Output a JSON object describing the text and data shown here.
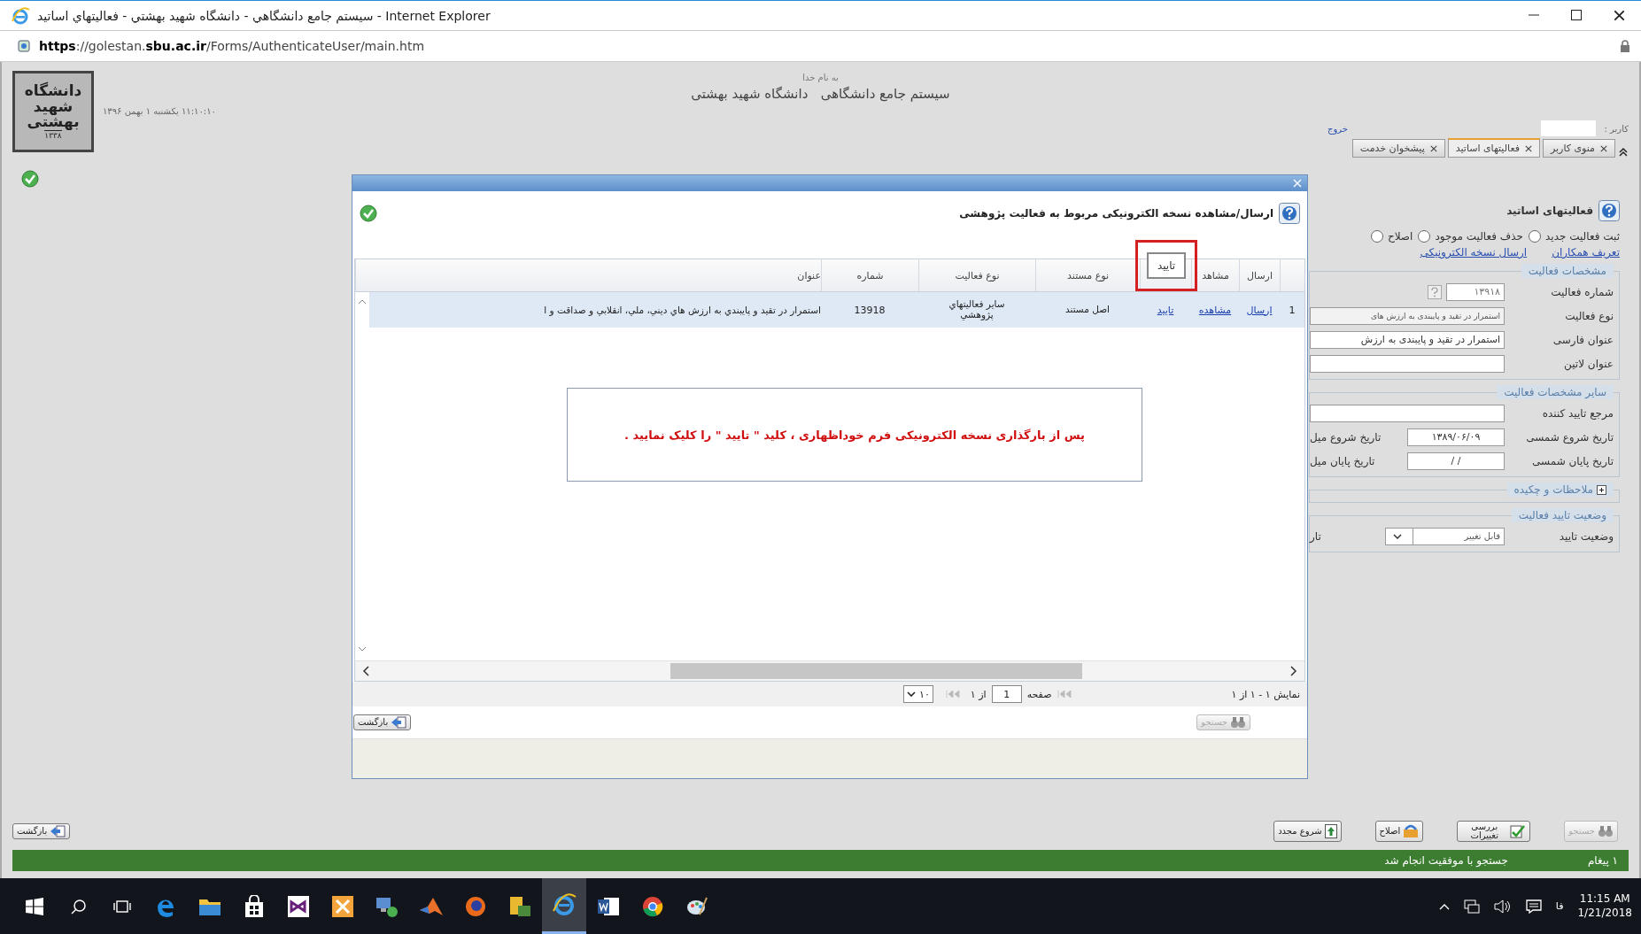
{
  "window": {
    "title": "Internet Explorer - سيستم جامع دانشگاهي - دانشگاه شهيد بهشتي - فعاليتهاي اساتيد"
  },
  "address_bar": {
    "url": "**https**://golestan.**sbu.ac.ir**/Forms/AuthenticateUser/main.htm"
  },
  "header": {
    "logo_text": "دانشگاه شهید بهشتی",
    "logo_year": "۱۳۳۸",
    "date_time": "۱۱:۱۰:۱۰ یکشنبه ۱ بهمن ۱۳۹۶",
    "basmala": "به نام خدا",
    "system_title": "سیستم جامع دانشگاهی   دانشگاه شهید بهشتی",
    "user_label": "کاربر :",
    "logout": "خروج"
  },
  "tabs": [
    {
      "label": "منوی کاربر",
      "selected": false
    },
    {
      "label": "فعالیتهای اساتید",
      "selected": true
    },
    {
      "label": "پیشخوان خدمت",
      "selected": false
    }
  ],
  "panel": {
    "title": "فعالیتهای اساتید",
    "modes": [
      {
        "label": "ثبت فعالیت جدید",
        "selected": false
      },
      {
        "label": "حذف فعالیت موجود",
        "selected": false
      },
      {
        "label": "اصلاح",
        "selected": false
      }
    ],
    "links": [
      "تعریف همکاران",
      "ارسال نسخه الکترونیکی"
    ],
    "sections": [
      {
        "legend": "مشخصات فعالیت",
        "expanded": true,
        "rows": [
          {
            "label": "شماره فعالیت",
            "value": "۱۳۹۱۸",
            "kind": "number"
          },
          {
            "label": "نوع فعالیت",
            "value": "استمرار در تقيد و پايبندی به ارزش های",
            "kind": "readonly"
          },
          {
            "label": "عنوان فارسی",
            "value": "استمرار در تقيد و پايبندی به ارزش",
            "kind": "text"
          },
          {
            "label": "عنوان لاتین",
            "kind": "text"
          }
        ]
      },
      {
        "legend": "سایر مشخصات فعالیت",
        "expanded": true,
        "rows": [
          {
            "label": "مرجع تایید کننده",
            "kind": "text"
          },
          {
            "label": "تاریخ شروع شمسی",
            "value": "۱۳۸۹/۰۶/۰۹",
            "kind": "date",
            "extra": "تاریخ شروع میل"
          },
          {
            "label": "تاریخ پایان شمسی",
            "value": "/   /",
            "kind": "date",
            "extra": "تاریخ پایان میل"
          }
        ]
      },
      {
        "legend": "ملاحظات و چکیده",
        "expanded": false
      },
      {
        "legend": "وضعیت تایید فعالیت",
        "expanded": true,
        "rows": [
          {
            "label": "وضعیت تایید",
            "value": "قابل تغییر",
            "kind": "select",
            "extra": "تار"
          }
        ]
      }
    ]
  },
  "dialog": {
    "title": "ارسال/مشاهده نسخه الکترونیکی مربوط به فعالیت پژوهشی",
    "columns": [
      {
        "highlighted": false
      },
      {
        "label": "ارسال",
        "highlighted": false
      },
      {
        "label": "مشاهد",
        "highlighted": false
      },
      {
        "label": "تایید",
        "highlighted": true
      },
      {
        "label": "نوع مستند",
        "highlighted": false
      },
      {
        "label": "نوع فعالیت",
        "highlighted": false
      },
      {
        "label": "شماره",
        "highlighted": false
      },
      {
        "label": "عنوان",
        "highlighted": false
      }
    ],
    "rows": [
      {
        "selected": true,
        "cells": [
          {
            "kind": "index",
            "text": "1"
          },
          {
            "kind": "link",
            "text": "ارسال"
          },
          {
            "kind": "link",
            "text": "مشاهده"
          },
          {
            "kind": "link",
            "text": "تاييد"
          },
          {
            "kind": "text",
            "text": "اصل مستند"
          },
          {
            "kind": "text",
            "text": "سایر فعالیتهاي پژوهشي"
          },
          {
            "kind": "number",
            "text": "13918"
          },
          {
            "kind": "title",
            "text": "استمرار در تقيد و پايبندي به ارزش هاي ديني، ملي، انقلابي و صداقت و ا"
          }
        ]
      }
    ],
    "notice": "پس از بارگذاری نسخه الکترونیکی فرم خوداظهاری ، کلید \" تایید \" را کلیک نمایید .",
    "pager": {
      "summary": "نمایش ۱ - ۱ از ۱",
      "page_label": "صفحه",
      "page": "1",
      "of": "از ۱",
      "page_size": "۱۰"
    },
    "back": "بازگشت",
    "search": {
      "label": "جستجو",
      "disabled": true
    }
  },
  "back_button": "بازگشت",
  "actions": [
    {
      "label": "جستجو",
      "disabled": true,
      "kind": "search"
    },
    {
      "label": "بررسی تغییرات",
      "disabled": false,
      "kind": "review"
    },
    {
      "label": "اصلاح",
      "disabled": false,
      "kind": "edit"
    },
    {
      "label": "شروع مجدد",
      "disabled": false,
      "kind": "restart"
    }
  ],
  "status_bar": {
    "count": "۱ پیغام",
    "message": "جستجو با موفقیت انجام شد"
  },
  "taskbar": {
    "apps": [
      {
        "kind": "edge",
        "selected": false
      },
      {
        "kind": "folder",
        "selected": false
      },
      {
        "kind": "store",
        "selected": false
      },
      {
        "kind": "vs",
        "selected": false
      },
      {
        "kind": "tool",
        "selected": false
      },
      {
        "kind": "network",
        "selected": false
      },
      {
        "kind": "matlab",
        "selected": false
      },
      {
        "kind": "firefox",
        "selected": false
      },
      {
        "kind": "server",
        "selected": false
      },
      {
        "kind": "ie",
        "selected": true
      },
      {
        "kind": "word",
        "selected": false
      },
      {
        "kind": "chrome",
        "selected": false
      },
      {
        "kind": "paint",
        "selected": false
      }
    ],
    "language": "فا",
    "time": "11:15 AM",
    "date": "1/21/2018"
  }
}
